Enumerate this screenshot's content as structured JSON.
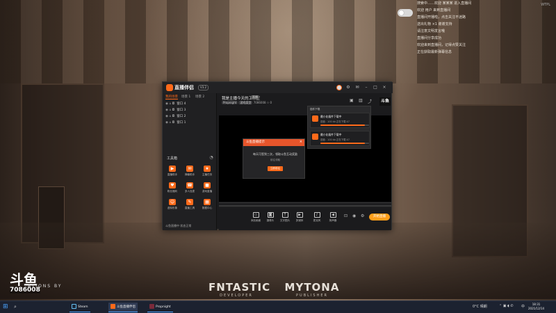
{
  "notifications": [
    "搜索中……欢迎 某某某 进入直播间",
    "欢迎 用户 来到直播间",
    "直播间开播啦，点击关注不迷路",
    "送出礼物 ×1 谢谢支持",
    "请注意文明发言哦",
    "直播间分享成功",
    "欢迎来到直播间，记得点赞关注",
    "正在获取最新弹幕信息"
  ],
  "watermark": "WTPL",
  "app": {
    "name": "直播伴侣",
    "version": "V3.2",
    "left_tabs": [
      "我的场景",
      "场景 1",
      "场景 2"
    ],
    "scenes": [
      "窗口 4",
      "窗口 3",
      "窗口 2",
      "窗口 1"
    ],
    "tools_title": "工具箱",
    "tools": [
      {
        "label": "直播助手",
        "icon": "▶"
      },
      {
        "label": "弹幕助手",
        "icon": "✉"
      },
      {
        "label": "主播任务",
        "icon": "★"
      },
      {
        "label": "粉丝福利",
        "icon": "♥"
      },
      {
        "label": "多人连麦",
        "icon": "☎"
      },
      {
        "label": "游戏直播",
        "icon": "■"
      },
      {
        "label": "虚拟形象",
        "icon": "☺"
      },
      {
        "label": "直播工具",
        "icon": "✎"
      },
      {
        "label": "数据中心",
        "icon": "▦"
      }
    ],
    "status_text": "斗鱼直播中 状态正常",
    "main_title": "我是主播今天的工作室",
    "main_tag": "直播",
    "main_meta_chip1": "Propnight",
    "main_meta_chip2": "游戏类型",
    "main_meta_rest": "7086008  ✩ 0",
    "mini_brand": "斗鱼",
    "bottom_items": [
      "添加画面",
      "摄像头",
      "文字图片",
      "多媒体"
    ],
    "bottom_items2": [
      "麦克风",
      "扬声器"
    ],
    "go_live": "开始直播"
  },
  "dialog": {
    "title": "斗鱼直播提示",
    "text": "每天可签到三次，领取斗鱼互动奖励",
    "sub": "前往领取",
    "button": "立即前往"
  },
  "downloads": {
    "header": "插件下载",
    "items": [
      {
        "name": "最小化插件下载中",
        "progress_text": "进度：100 kb  正在下载 47",
        "progress": 0.92
      },
      {
        "name": "最小化插件下载中",
        "progress_text": "进度：100 kb  正在下载 47",
        "progress": 0.92
      }
    ]
  },
  "brands": {
    "left_big": "FNTASTIC",
    "left_small": "DEVELOPER",
    "right_big": "MYTONA",
    "right_small": "PUBLISHER"
  },
  "douyu": {
    "logo": "斗鱼",
    "room_number": "7086008",
    "credit": "ATIONS BY"
  },
  "taskbar": {
    "tasks": [
      "Steam",
      "斗鱼直播伴侣",
      "Propnight"
    ],
    "weather": "0°C 晴朗",
    "time": "18:31",
    "date": "2021/12/14",
    "lang": "中"
  }
}
